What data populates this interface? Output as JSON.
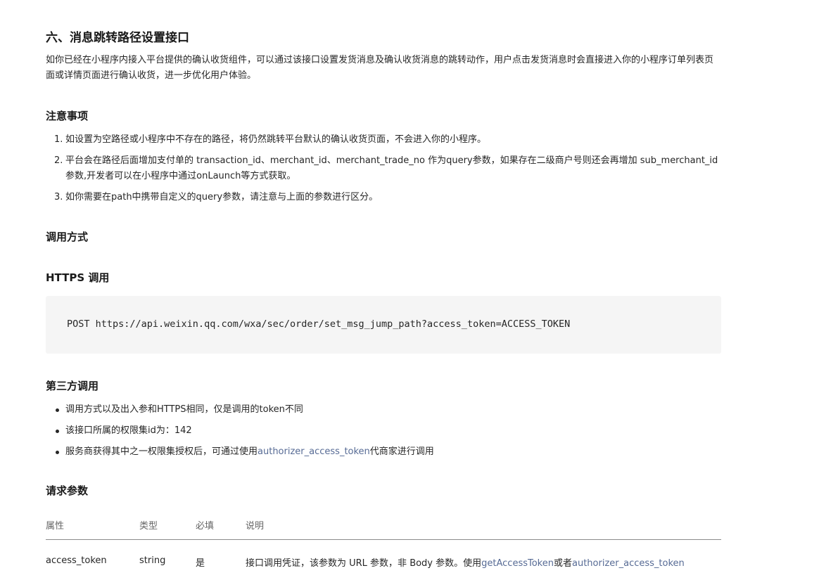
{
  "section_title": "六、消息跳转路径设置接口",
  "intro": "如你已经在小程序内接入平台提供的确认收货组件，可以通过该接口设置发货消息及确认收货消息的跳转动作，用户点击发货消息时会直接进入你的小程序订单列表页面或详情页面进行确认收货，进一步优化用户体验。",
  "notes": {
    "heading": "注意事项",
    "items": [
      {
        "num": "1.",
        "text": "如设置为空路径或小程序中不存在的路径，将仍然跳转平台默认的确认收货页面，不会进入你的小程序。"
      },
      {
        "num": "2.",
        "text": "平台会在路径后面增加支付单的 transaction_id、merchant_id、merchant_trade_no 作为query参数，如果存在二级商户号则还会再增加 sub_merchant_id 参数,开发者可以在小程序中通过onLaunch等方式获取。"
      },
      {
        "num": "3.",
        "text": "如你需要在path中携带自定义的query参数，请注意与上面的参数进行区分。"
      }
    ]
  },
  "call_method": {
    "heading": "调用方式"
  },
  "https": {
    "heading": "HTTPS 调用",
    "code": "POST https://api.weixin.qq.com/wxa/sec/order/set_msg_jump_path?access_token=ACCESS_TOKEN"
  },
  "third_party": {
    "heading": "第三方调用",
    "items": [
      {
        "text": "调用方式以及出入参和HTTPS相同，仅是调用的token不同"
      },
      {
        "text": "该接口所属的权限集id为：142"
      },
      {
        "before": "服务商获得其中之一权限集授权后，可通过使用",
        "link": "authorizer_access_token",
        "after": "代商家进行调用"
      }
    ]
  },
  "params": {
    "heading": "请求参数",
    "columns": [
      "属性",
      "类型",
      "必填",
      "说明"
    ],
    "rows": [
      {
        "name": "access_token",
        "type": "string",
        "required": "是",
        "desc_before": "接口调用凭证，该参数为 URL 参数，非 Body 参数。使用",
        "desc_link1": "getAccessToken",
        "desc_mid": "或者",
        "desc_link2": "authorizer_access_token"
      }
    ]
  },
  "colors": {
    "link": "#576b95",
    "code_bg": "#f5f5f5",
    "text": "#262626"
  }
}
